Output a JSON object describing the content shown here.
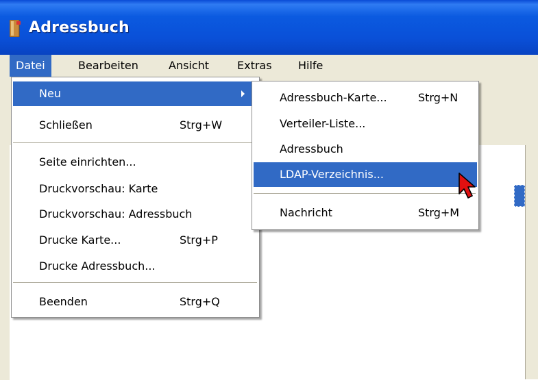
{
  "window": {
    "title": "Adressbuch"
  },
  "menubar": {
    "items": [
      "Datei",
      "Bearbeiten",
      "Ansicht",
      "Extras",
      "Hilfe"
    ]
  },
  "file_menu": {
    "items": [
      {
        "label": "Neu",
        "shortcut": ""
      },
      {
        "label": "Schließen",
        "shortcut": "Strg+W"
      },
      {
        "label": "Seite einrichten...",
        "shortcut": ""
      },
      {
        "label": "Druckvorschau: Karte",
        "shortcut": ""
      },
      {
        "label": "Druckvorschau: Adressbuch",
        "shortcut": ""
      },
      {
        "label": "Drucke Karte...",
        "shortcut": "Strg+P"
      },
      {
        "label": "Drucke Adressbuch...",
        "shortcut": ""
      },
      {
        "label": "Beenden",
        "shortcut": "Strg+Q"
      }
    ]
  },
  "new_submenu": {
    "items": [
      {
        "label": "Adressbuch-Karte...",
        "shortcut": "Strg+N"
      },
      {
        "label": "Verteiler-Liste...",
        "shortcut": ""
      },
      {
        "label": "Adressbuch",
        "shortcut": ""
      },
      {
        "label": "LDAP-Verzeichnis...",
        "shortcut": ""
      },
      {
        "label": "Nachricht",
        "shortcut": "Strg+M"
      }
    ]
  },
  "colors": {
    "titlebar": "#0a50d8",
    "highlight": "#316ac5",
    "menu_bg": "#ffffff",
    "chrome": "#ece9d8"
  }
}
